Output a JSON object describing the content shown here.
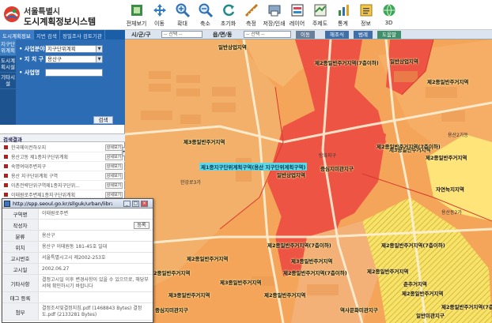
{
  "app": {
    "title_line1": "서울특별시",
    "title_line2": "도시계획정보시스템"
  },
  "toolbar": [
    {
      "label": "전체보기",
      "icon": "full-view-icon"
    },
    {
      "label": "이동",
      "icon": "pan-arrows-icon"
    },
    {
      "label": "확대",
      "icon": "zoom-in-icon"
    },
    {
      "label": "축소",
      "icon": "zoom-out-icon"
    },
    {
      "label": "초기화",
      "icon": "refresh-icon"
    },
    {
      "label": "측정",
      "icon": "measure-icon"
    },
    {
      "label": "저장/인쇄",
      "icon": "save-print-icon"
    },
    {
      "label": "레이어",
      "icon": "layer-icon"
    },
    {
      "label": "주제도",
      "icon": "thematic-map-icon"
    },
    {
      "label": "통계",
      "icon": "statistics-icon"
    },
    {
      "label": "정보",
      "icon": "info-icon"
    },
    {
      "label": "3D",
      "icon": "globe-3d-icon"
    }
  ],
  "sidebar": {
    "tabs": [
      "도시계획정보",
      "지번 검색",
      "정밀조사 검토기관"
    ],
    "vertical_tabs": [
      "지구단위계획",
      "도시계획시설",
      "기타시설"
    ],
    "fields": [
      {
        "label": "사업분야",
        "value": "지구단위계획"
      },
      {
        "label": "지 치 구",
        "value": "용산구"
      },
      {
        "label": "사업명",
        "value": ""
      }
    ],
    "search_button": "검색",
    "results_header": "검색결과",
    "results": [
      {
        "text": "한국메이컨하우지",
        "button": "상세보기"
      },
      {
        "text": "용산고동 제1종지구단위계획",
        "button": "상세보기"
      },
      {
        "text": "숙명여대주변지구",
        "button": "상세보기"
      },
      {
        "text": "용산 지구단위계획 구역",
        "button": "상세보기"
      },
      {
        "text": "이촌전략단위구역제1종지구단위...",
        "button": "상세보기"
      },
      {
        "text": "이태원로주변제1종지구단위계획",
        "button": "상세보기"
      },
      {
        "text": "한남제1종지구단위계획",
        "button": "상세보기"
      }
    ]
  },
  "maptoolbar": {
    "sido_label": "시/군/구",
    "sido_value": "-- 선택 --",
    "dong_label": "읍/면/동",
    "dong_value": "-- 선택 --",
    "move_button": "이동",
    "btn_area": "해조식",
    "btn_legend": "범례",
    "btn_help": "도움말"
  },
  "map": {
    "labels": [
      {
        "text": "일반상업지역",
        "type": "normal"
      },
      {
        "text": "제2종일반주거지역(7층이하)",
        "type": "normal"
      },
      {
        "text": "일반상업지역",
        "type": "normal"
      },
      {
        "text": "제2종일반주거지역",
        "type": "normal"
      },
      {
        "text": "제3종일반주거지역",
        "type": "normal"
      },
      {
        "text": "제1종지구단위계획구역(용산 지구단위계획구역)",
        "type": "cyan"
      },
      {
        "text": "방화지구",
        "type": "thin"
      },
      {
        "text": "일반상업지역",
        "type": "normal"
      },
      {
        "text": "중심지미관지구",
        "type": "normal"
      },
      {
        "text": "제3종일반주거지역",
        "type": "normal"
      },
      {
        "text": "제2종일반주거지역(7층이하)",
        "type": "normal"
      },
      {
        "text": "제2종일반주거지역",
        "type": "normal"
      },
      {
        "text": "자연녹지지역",
        "type": "normal"
      },
      {
        "text": "제2종일반주거지역(7층이하)",
        "type": "normal"
      },
      {
        "text": "제2종일반주거지역(7층이하)",
        "type": "normal"
      },
      {
        "text": "제2종일반주거지역",
        "type": "normal"
      },
      {
        "text": "제3종일반주거지역",
        "type": "normal"
      },
      {
        "text": "제2종일반주거지역",
        "type": "normal"
      },
      {
        "text": "제2종일반주거지역(7층이하)",
        "type": "normal"
      },
      {
        "text": "제2종일반주거지역",
        "type": "normal"
      },
      {
        "text": "제3종일반주거지역",
        "type": "normal"
      },
      {
        "text": "제2종일반주거지역",
        "type": "normal"
      },
      {
        "text": "춘추거지역",
        "type": "normal"
      },
      {
        "text": "제3종일반주거지역",
        "type": "normal"
      },
      {
        "text": "제2종일반주거지역",
        "type": "normal"
      },
      {
        "text": "제2종일반주거지역(7층이하)",
        "type": "normal"
      },
      {
        "text": "중심지미관지구",
        "type": "normal"
      },
      {
        "text": "역사문화미관지구",
        "type": "normal"
      },
      {
        "text": "일반미관지구",
        "type": "normal"
      },
      {
        "text": "한강로3가",
        "type": "thin"
      },
      {
        "text": "용산2가동",
        "type": "thin"
      },
      {
        "text": "용산동2가",
        "type": "thin"
      }
    ]
  },
  "popup": {
    "url": "http://spp.seoul.go.kr/sllguk/urban/library...",
    "rows": [
      {
        "key": "구역명",
        "value": "이태원로주변"
      },
      {
        "key": "작성자",
        "value": "",
        "button": "등록"
      },
      {
        "key": "분류",
        "value": "용산구"
      },
      {
        "key": "위치",
        "value": "용산구 이태원동 181-45호 일대"
      },
      {
        "key": "고시번호",
        "value": "서울특별시고시 제2002-253호"
      },
      {
        "key": "고시일",
        "value": "2002.06.27"
      },
      {
        "key": "기타사항",
        "value": "결정고시일 이후 변경사항이 있을 수 있으므로, 해당부서에 확인하시기 바랍니다"
      },
      {
        "key": "태그 등록",
        "value": ""
      },
      {
        "key": "첨부",
        "value": "결정조서및결정지침.pdf (1468843 Bytes) 결정도.pdf (2133281 Bytes)"
      }
    ]
  },
  "colors": {
    "residential_2": "#f5a55a",
    "residential_3": "#f2935e",
    "commercial": "#ee5444",
    "natural_green": "#ffe47a",
    "hatch_zone": "#f8e36a",
    "district_blue": "#1b5ea8"
  }
}
